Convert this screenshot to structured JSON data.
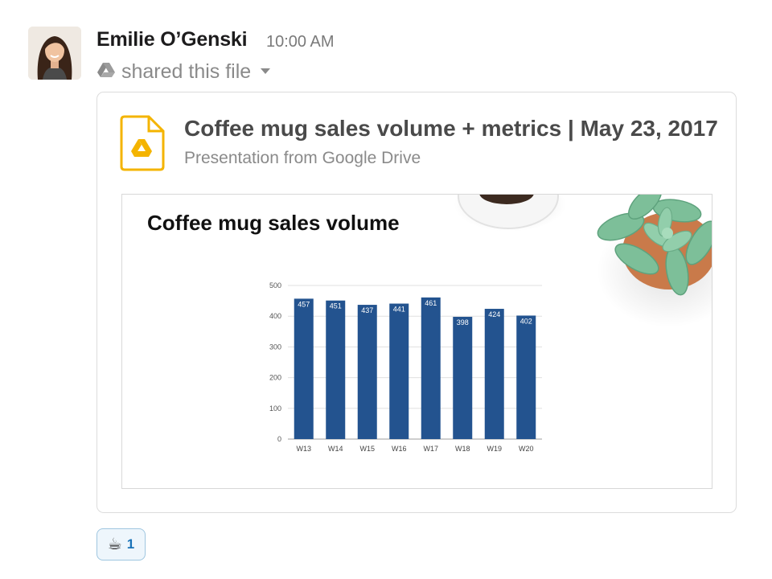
{
  "message": {
    "author": "Emilie O’Genski",
    "time": "10:00 AM",
    "action": "shared this file",
    "avatar_icon": "user-avatar-photo"
  },
  "file": {
    "title": "Coffee mug sales volume + metrics | May 23, 2017",
    "subtitle": "Presentation from Google Drive",
    "icon": "google-drive-icon",
    "icon_color": "#f4b400"
  },
  "slide": {
    "title": "Coffee mug sales volume"
  },
  "chart_data": {
    "type": "bar",
    "title": "",
    "xlabel": "",
    "ylabel": "",
    "categories": [
      "W13",
      "W14",
      "W15",
      "W16",
      "W17",
      "W18",
      "W19",
      "W20"
    ],
    "values": [
      457,
      451,
      437,
      441,
      461,
      398,
      424,
      402
    ],
    "ylim": [
      0,
      500
    ],
    "yticks": [
      0,
      100,
      200,
      300,
      400,
      500
    ],
    "bar_color": "#23538f",
    "data_labels": true,
    "grid": true
  },
  "reaction": {
    "emoji": "☕",
    "count": "1"
  },
  "colors": {
    "author": "#1d1c1d",
    "muted": "#8a8a8a",
    "reaction_border": "#9fc6e0",
    "reaction_bg": "#eef6fc",
    "reaction_count": "#1a73b8"
  }
}
